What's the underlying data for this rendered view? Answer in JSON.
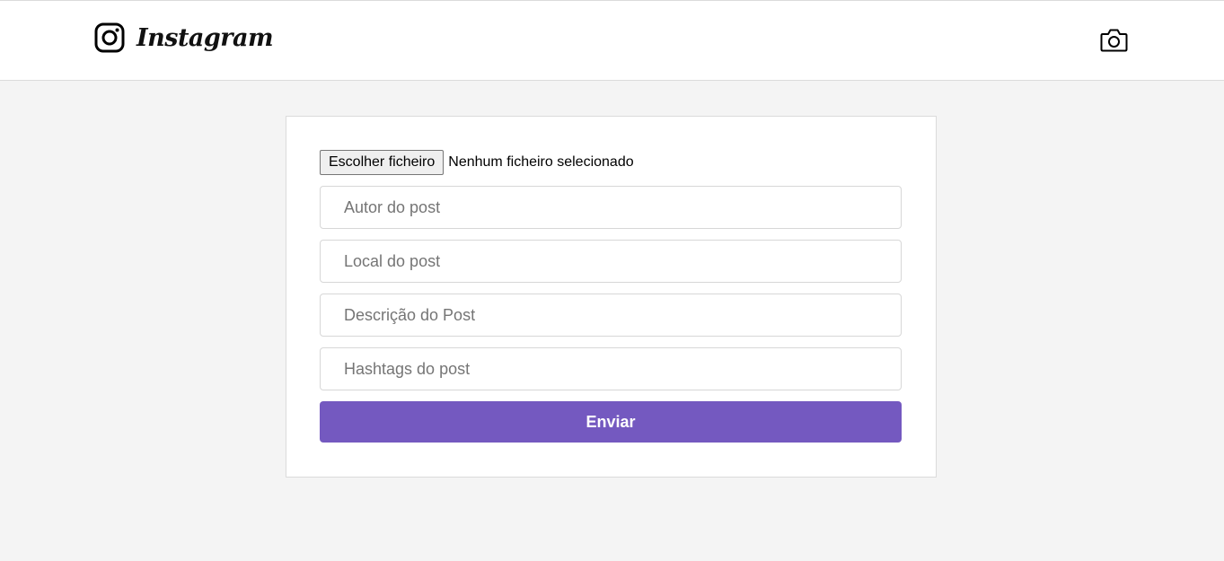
{
  "header": {
    "brand": "Instagram",
    "logo_icon": "instagram-logo-icon",
    "action_icon": "camera-icon"
  },
  "form": {
    "file_button_label": "Escolher ficheiro",
    "file_status": "Nenhum ficheiro selecionado",
    "fields": [
      {
        "placeholder": "Autor do post"
      },
      {
        "placeholder": "Local do post"
      },
      {
        "placeholder": "Descrição do Post"
      },
      {
        "placeholder": "Hashtags do post"
      }
    ],
    "submit_label": "Enviar"
  },
  "colors": {
    "accent": "#7459c0",
    "page_background": "#f4f4f4",
    "surface": "#ffffff",
    "border": "#dbdbdb"
  }
}
